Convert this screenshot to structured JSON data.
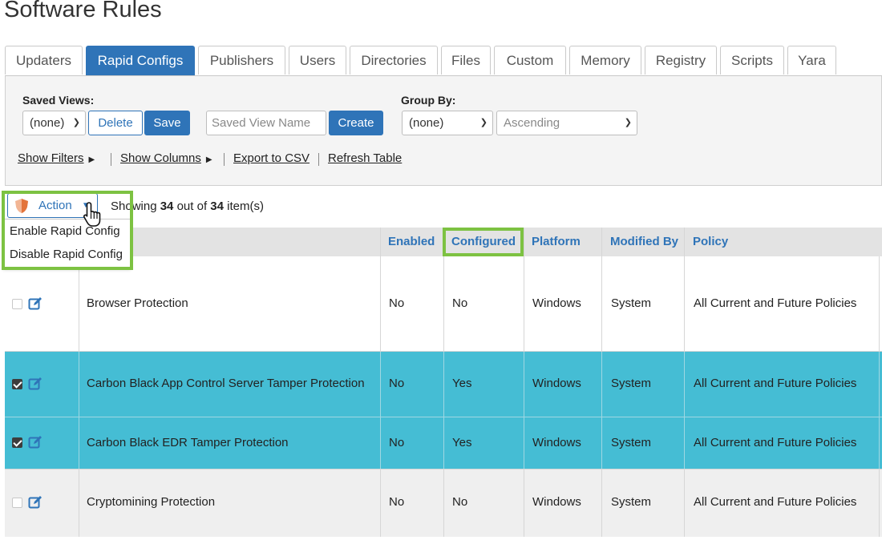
{
  "page": {
    "title": "Software Rules"
  },
  "tabs": [
    "Updaters",
    "Rapid Configs",
    "Publishers",
    "Users",
    "Directories",
    "Files",
    "Custom",
    "Memory",
    "Registry",
    "Scripts",
    "Yara"
  ],
  "active_tab": "Rapid Configs",
  "filters": {
    "saved_views_label": "Saved Views:",
    "saved_views_value": "(none)",
    "delete_label": "Delete",
    "save_label": "Save",
    "view_name_placeholder": "Saved View Name",
    "create_label": "Create",
    "group_by_label": "Group By:",
    "group_by_value": "(none)",
    "order_value": "Ascending",
    "links": [
      "Show Filters",
      "Show Columns",
      "Export to CSV",
      "Refresh Table"
    ]
  },
  "action": {
    "label": "Action",
    "menu": [
      "Enable Rapid Config",
      "Disable Rapid Config"
    ]
  },
  "showing": {
    "prefix": "Showing",
    "shown": "34",
    "middle": "out of",
    "total": "34",
    "suffix": "item(s)"
  },
  "columns": [
    "Enabled",
    "Configured",
    "Platform",
    "Modified By",
    "Policy"
  ],
  "rows": [
    {
      "name": "Browser Protection",
      "enabled": "No",
      "configured": "No",
      "platform": "Windows",
      "modified_by": "System",
      "policy": "All Current and Future Policies",
      "checked": false
    },
    {
      "name": "Carbon Black App Control Server Tamper Protection",
      "enabled": "No",
      "configured": "Yes",
      "platform": "Windows",
      "modified_by": "System",
      "policy": "All Current and Future Policies",
      "checked": true
    },
    {
      "name": "Carbon Black EDR Tamper Protection",
      "enabled": "No",
      "configured": "Yes",
      "platform": "Windows",
      "modified_by": "System",
      "policy": "All Current and Future Policies",
      "checked": true
    },
    {
      "name": "Cryptomining Protection",
      "enabled": "No",
      "configured": "No",
      "platform": "Windows",
      "modified_by": "System",
      "policy": "All Current and Future Policies",
      "checked": false
    }
  ],
  "colors": {
    "accent": "#2f74b8",
    "selected_row": "#45bdd4",
    "highlight": "#7dc242"
  }
}
